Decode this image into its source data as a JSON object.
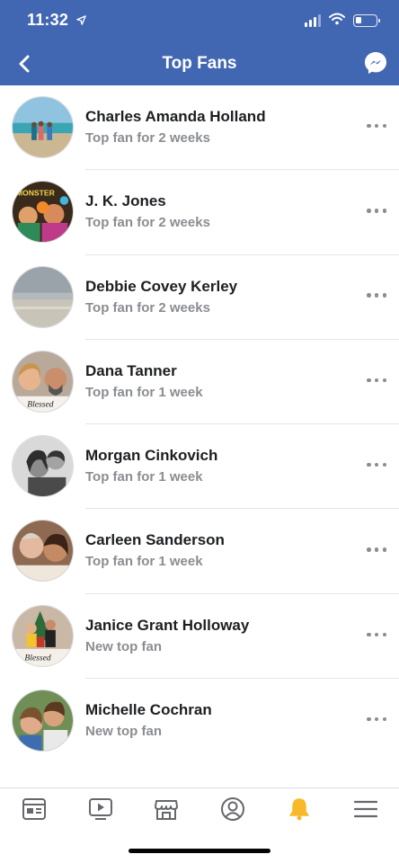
{
  "status_bar": {
    "time": "11:32",
    "location_icon": "location-arrow-icon",
    "icons": [
      "cellular-signal-icon",
      "wifi-icon",
      "battery-icon"
    ]
  },
  "nav": {
    "title": "Top Fans",
    "back_icon": "back-chevron-icon",
    "right_icon": "messenger-icon"
  },
  "fans": [
    {
      "name": "Charles Amanda Holland",
      "status": "Top fan for 2 weeks"
    },
    {
      "name": "J. K. Jones",
      "status": "Top fan for 2 weeks",
      "avatar_text": "MONSTER"
    },
    {
      "name": "Debbie Covey Kerley",
      "status": "Top fan for 2 weeks"
    },
    {
      "name": "Dana Tanner",
      "status": "Top fan for 1 week",
      "avatar_text": "Blessed"
    },
    {
      "name": "Morgan Cinkovich",
      "status": "Top fan for 1 week"
    },
    {
      "name": "Carleen Sanderson",
      "status": "Top fan for 1 week"
    },
    {
      "name": "Janice Grant Holloway",
      "status": "New top fan",
      "avatar_text": "Blessed"
    },
    {
      "name": "Michelle Cochran",
      "status": "New top fan"
    }
  ],
  "tabbar": {
    "tabs": [
      "news-feed-icon",
      "watch-icon",
      "marketplace-icon",
      "profile-icon",
      "notifications-bell-icon",
      "menu-icon"
    ],
    "active_tab": "notifications-bell-icon",
    "active_color": "#f7b928"
  },
  "colors": {
    "header_blue": "#4267b2",
    "name_text": "#1c1e21",
    "secondary_text": "#8a8d91"
  }
}
